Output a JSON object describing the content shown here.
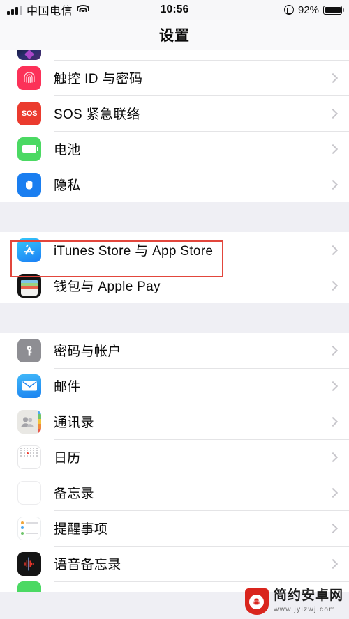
{
  "status_bar": {
    "carrier": "中国电信",
    "signal_icon": "signal-bars-icon",
    "wifi_icon": "wifi-icon",
    "time": "10:56",
    "rotation_lock_icon": "rotation-lock-icon",
    "battery_percent": "92%",
    "battery_icon": "battery-icon"
  },
  "navbar": {
    "title": "设置"
  },
  "groups": [
    {
      "id": "group-security",
      "rows": [
        {
          "label": "",
          "icon": "face-id-icon",
          "partial": "top"
        },
        {
          "label": "触控 ID 与密码",
          "icon": "touch-id-icon"
        },
        {
          "label": "SOS 紧急联络",
          "icon": "sos-icon",
          "icon_text": "SOS"
        },
        {
          "label": "电池",
          "icon": "battery-settings-icon"
        },
        {
          "label": "隐私",
          "icon": "privacy-hand-icon"
        }
      ]
    },
    {
      "id": "group-store",
      "rows": [
        {
          "label": "iTunes Store 与 App Store",
          "icon": "app-store-icon",
          "highlighted": true
        },
        {
          "label": "钱包与 Apple Pay",
          "icon": "wallet-icon"
        }
      ]
    },
    {
      "id": "group-apps",
      "rows": [
        {
          "label": "密码与帐户",
          "icon": "passwords-key-icon"
        },
        {
          "label": "邮件",
          "icon": "mail-envelope-icon"
        },
        {
          "label": "通讯录",
          "icon": "contacts-icon"
        },
        {
          "label": "日历",
          "icon": "calendar-icon"
        },
        {
          "label": "备忘录",
          "icon": "notes-icon"
        },
        {
          "label": "提醒事项",
          "icon": "reminders-icon"
        },
        {
          "label": "语音备忘录",
          "icon": "voice-memos-icon"
        },
        {
          "label": "",
          "icon": "phone-green-icon",
          "partial": "bottom"
        }
      ]
    }
  ],
  "chevron_icon": "chevron-right-icon",
  "highlight": {
    "color": "#e2463c",
    "target_label": "iTunes Store 与 App Store"
  },
  "watermark": {
    "title": "简约安卓网",
    "url": "www.jyizwj.com",
    "logo_icon": "android-shield-logo-icon"
  },
  "colors": {
    "page_background": "#efeff4",
    "row_background": "#ffffff",
    "separator": "#e4e4e6",
    "text": "#0a0a0a",
    "chevron": "#c8c7cc",
    "highlight_red": "#e2463c",
    "touch_id_pink": "#fc3158",
    "sos_red": "#eb3b2e",
    "battery_green": "#4bd963",
    "privacy_blue": "#1a7ef0",
    "app_store_blue": "#1b7ef5",
    "wallet_black": "#141414",
    "key_gray": "#8e8e93",
    "mail_blue": "#1a82f0",
    "calendar_red": "#ed3b2f",
    "notes_yellow": "#f5c518",
    "voice_black": "#151515",
    "watermark_red": "#d9251d"
  }
}
